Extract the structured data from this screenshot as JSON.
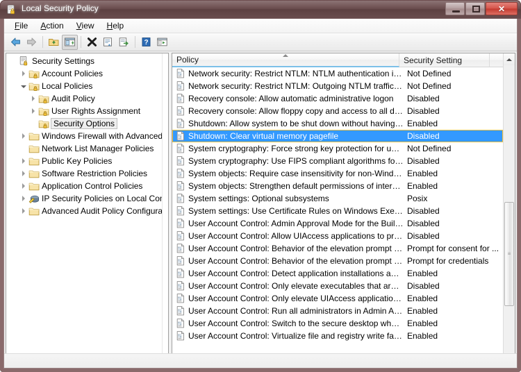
{
  "window": {
    "title": "Local Security Policy",
    "icon": "security-policy-icon",
    "buttons": {
      "minimize": "minimize-button",
      "maximize": "maximize-button",
      "close_label": "✕"
    }
  },
  "menubar": {
    "items": [
      {
        "label": "File",
        "accel": "F"
      },
      {
        "label": "Action",
        "accel": "A"
      },
      {
        "label": "View",
        "accel": "V"
      },
      {
        "label": "Help",
        "accel": "H"
      }
    ]
  },
  "toolbar": {
    "buttons": [
      {
        "name": "back-button",
        "icon": "arrow-left-icon",
        "pressed": false
      },
      {
        "name": "forward-button",
        "icon": "arrow-right-icon",
        "pressed": false
      },
      {
        "name": "up-one-level-button",
        "icon": "folder-up-icon",
        "pressed": false
      },
      {
        "name": "show-hide-tree-button",
        "icon": "console-tree-icon",
        "pressed": true
      },
      {
        "name": "delete-button",
        "icon": "delete-x-icon",
        "pressed": false
      },
      {
        "name": "properties-button",
        "icon": "properties-icon",
        "pressed": false
      },
      {
        "name": "export-list-button",
        "icon": "export-list-icon",
        "pressed": false
      },
      {
        "name": "help-button",
        "icon": "help-question-icon",
        "pressed": false
      },
      {
        "name": "view-options-button",
        "icon": "view-options-icon",
        "pressed": false
      }
    ]
  },
  "tree": {
    "items": [
      {
        "label": "Security Settings",
        "indent": 0,
        "expander": "none",
        "icon": "security-settings-icon",
        "selected": false
      },
      {
        "label": "Account Policies",
        "indent": 1,
        "expander": "collapsed",
        "icon": "folder-lock-icon",
        "selected": false
      },
      {
        "label": "Local Policies",
        "indent": 1,
        "expander": "expanded",
        "icon": "folder-lock-icon",
        "selected": false
      },
      {
        "label": "Audit Policy",
        "indent": 2,
        "expander": "collapsed",
        "icon": "folder-lock-icon",
        "selected": false
      },
      {
        "label": "User Rights Assignment",
        "indent": 2,
        "expander": "collapsed",
        "icon": "folder-lock-icon",
        "selected": false
      },
      {
        "label": "Security Options",
        "indent": 2,
        "expander": "none",
        "icon": "folder-lock-icon",
        "selected": true
      },
      {
        "label": "Windows Firewall with Advanced Secu",
        "indent": 1,
        "expander": "collapsed",
        "icon": "folder-icon",
        "selected": false
      },
      {
        "label": "Network List Manager Policies",
        "indent": 1,
        "expander": "none",
        "icon": "folder-icon",
        "selected": false
      },
      {
        "label": "Public Key Policies",
        "indent": 1,
        "expander": "collapsed",
        "icon": "folder-icon",
        "selected": false
      },
      {
        "label": "Software Restriction Policies",
        "indent": 1,
        "expander": "collapsed",
        "icon": "folder-icon",
        "selected": false
      },
      {
        "label": "Application Control Policies",
        "indent": 1,
        "expander": "collapsed",
        "icon": "folder-icon",
        "selected": false
      },
      {
        "label": "IP Security Policies on Local Comput",
        "indent": 1,
        "expander": "collapsed",
        "icon": "ip-security-icon",
        "selected": false
      },
      {
        "label": "Advanced Audit Policy Configuration",
        "indent": 1,
        "expander": "collapsed",
        "icon": "folder-icon",
        "selected": false
      }
    ]
  },
  "list": {
    "columns": [
      {
        "label": "Policy",
        "sorted": true,
        "sort_direction": "ascending"
      },
      {
        "label": "Security Setting",
        "sorted": false,
        "sort_direction": ""
      }
    ],
    "rows": [
      {
        "policy": "Network security: Restrict NTLM: NTLM authentication in th...",
        "setting": "Not Defined",
        "selected": false
      },
      {
        "policy": "Network security: Restrict NTLM: Outgoing NTLM traffic to ...",
        "setting": "Not Defined",
        "selected": false
      },
      {
        "policy": "Recovery console: Allow automatic administrative logon",
        "setting": "Disabled",
        "selected": false
      },
      {
        "policy": "Recovery console: Allow floppy copy and access to all drives...",
        "setting": "Disabled",
        "selected": false
      },
      {
        "policy": "Shutdown: Allow system to be shut down without having to...",
        "setting": "Enabled",
        "selected": false
      },
      {
        "policy": "Shutdown: Clear virtual memory pagefile",
        "setting": "Disabled",
        "selected": true
      },
      {
        "policy": "System cryptography: Force strong key protection for user k...",
        "setting": "Not Defined",
        "selected": false
      },
      {
        "policy": "System cryptography: Use FIPS compliant algorithms for en...",
        "setting": "Disabled",
        "selected": false
      },
      {
        "policy": "System objects: Require case insensitivity for non-Windows ...",
        "setting": "Enabled",
        "selected": false
      },
      {
        "policy": "System objects: Strengthen default permissions of internal s...",
        "setting": "Enabled",
        "selected": false
      },
      {
        "policy": "System settings: Optional subsystems",
        "setting": "Posix",
        "selected": false
      },
      {
        "policy": "System settings: Use Certificate Rules on Windows Executabl...",
        "setting": "Disabled",
        "selected": false
      },
      {
        "policy": "User Account Control: Admin Approval Mode for the Built-i...",
        "setting": "Disabled",
        "selected": false
      },
      {
        "policy": "User Account Control: Allow UIAccess applications to prom...",
        "setting": "Disabled",
        "selected": false
      },
      {
        "policy": "User Account Control: Behavior of the elevation prompt for ...",
        "setting": "Prompt for consent for ...",
        "selected": false
      },
      {
        "policy": "User Account Control: Behavior of the elevation prompt for ...",
        "setting": "Prompt for credentials",
        "selected": false
      },
      {
        "policy": "User Account Control: Detect application installations and p...",
        "setting": "Enabled",
        "selected": false
      },
      {
        "policy": "User Account Control: Only elevate executables that are sign...",
        "setting": "Disabled",
        "selected": false
      },
      {
        "policy": "User Account Control: Only elevate UIAccess applications th...",
        "setting": "Enabled",
        "selected": false
      },
      {
        "policy": "User Account Control: Run all administrators in Admin Appr...",
        "setting": "Enabled",
        "selected": false
      },
      {
        "policy": "User Account Control: Switch to the secure desktop when pr...",
        "setting": "Enabled",
        "selected": false
      },
      {
        "policy": "User Account Control: Virtualize file and registry write failure...",
        "setting": "Enabled",
        "selected": false
      }
    ]
  },
  "colors": {
    "selection": "#3399ff",
    "selection_border": "#f0c040",
    "frame": "#6b4b4c",
    "sort_underline": "#7cc0e8"
  }
}
